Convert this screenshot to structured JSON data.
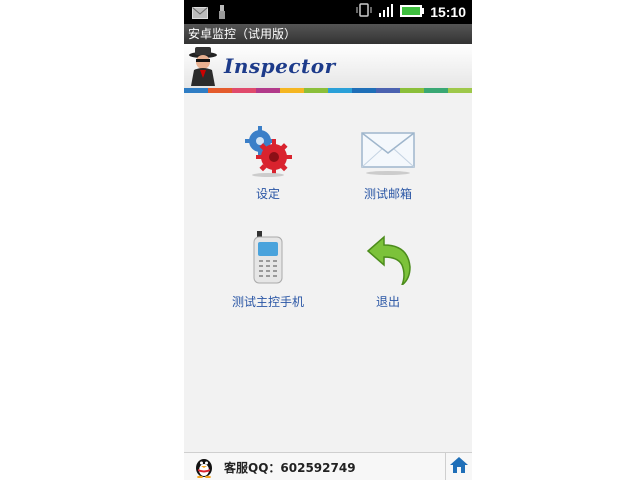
{
  "status_bar": {
    "time": "15:10"
  },
  "title_bar": {
    "title": "安卓监控（试用版）"
  },
  "header": {
    "brand": "Inspector"
  },
  "color_stripe": [
    "#2f7dc4",
    "#e45b2c",
    "#e04a6c",
    "#b23a8a",
    "#f5b621",
    "#8bbf3a",
    "#2aa0d8",
    "#1f6fb8",
    "#4b62b0",
    "#8bbf3a",
    "#3aa874",
    "#9ec84a"
  ],
  "menu": {
    "settings": {
      "label": "设定",
      "icon": "gears-icon"
    },
    "test_mail": {
      "label": "测试邮箱",
      "icon": "envelope-icon"
    },
    "test_phone": {
      "label": "测试主控手机",
      "icon": "phone-icon"
    },
    "exit": {
      "label": "退出",
      "icon": "back-arrow-icon"
    }
  },
  "bottom_bar": {
    "support_text": "客服QQ：602592749",
    "qq_icon": "penguin-icon",
    "home_icon": "home-icon"
  }
}
